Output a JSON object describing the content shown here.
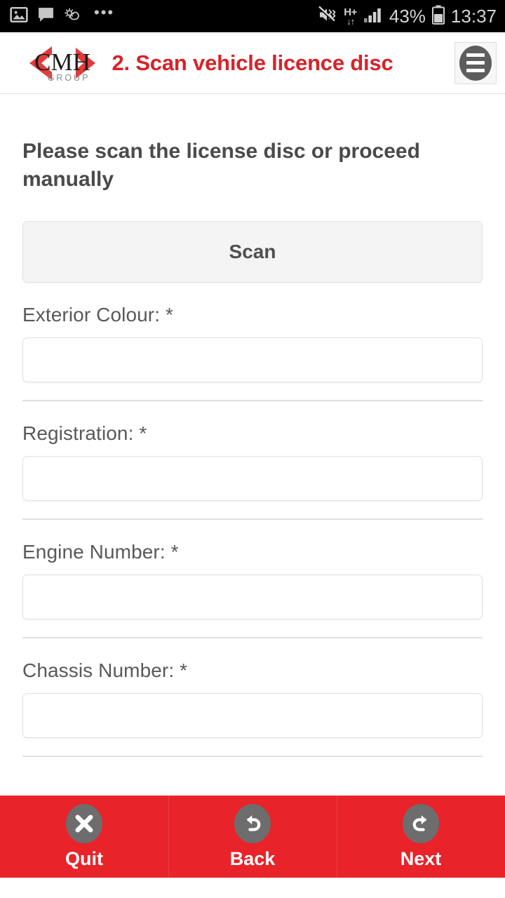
{
  "status_bar": {
    "left_icons": [
      "image-icon",
      "message-icon",
      "weather-icon",
      "more-dots-icon"
    ],
    "right_icons": [
      "mute-vibrate-icon",
      "network-hplus-icon",
      "signal-bars-icon",
      "battery-icon"
    ],
    "network_type": "H+",
    "battery_percent": "43%",
    "time": "13:37"
  },
  "header": {
    "logo_primary": "CMH",
    "logo_secondary": "GROUP",
    "title": "2. Scan vehicle licence disc",
    "menu_icon": "hamburger-menu-icon",
    "title_color": "#da2128"
  },
  "main": {
    "instruction": "Please scan the license disc or proceed manually",
    "scan_button": "Scan",
    "fields": [
      {
        "label": "Exterior Colour: *",
        "value": "",
        "placeholder": ""
      },
      {
        "label": "Registration: *",
        "value": "",
        "placeholder": ""
      },
      {
        "label": "Engine Number: *",
        "value": "",
        "placeholder": ""
      },
      {
        "label": "Chassis Number: *",
        "value": "",
        "placeholder": ""
      }
    ]
  },
  "bottom_nav": {
    "background_color": "#e8232a",
    "items": [
      {
        "label": "Quit",
        "icon": "close-x-icon"
      },
      {
        "label": "Back",
        "icon": "undo-arrow-icon"
      },
      {
        "label": "Next",
        "icon": "redo-arrow-icon"
      }
    ]
  }
}
